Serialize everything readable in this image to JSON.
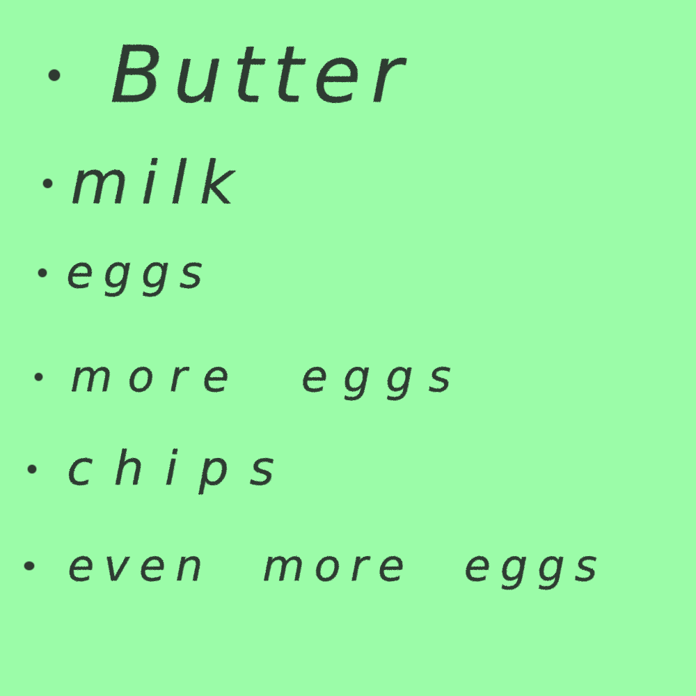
{
  "note": {
    "background_color": "#9bfca8",
    "ink_color": "#2e3a31",
    "items": [
      {
        "text": "Butter"
      },
      {
        "text": "milk"
      },
      {
        "text": "eggs"
      },
      {
        "text": "more eggs"
      },
      {
        "text": "chips"
      },
      {
        "text": "even more eggs"
      }
    ]
  }
}
